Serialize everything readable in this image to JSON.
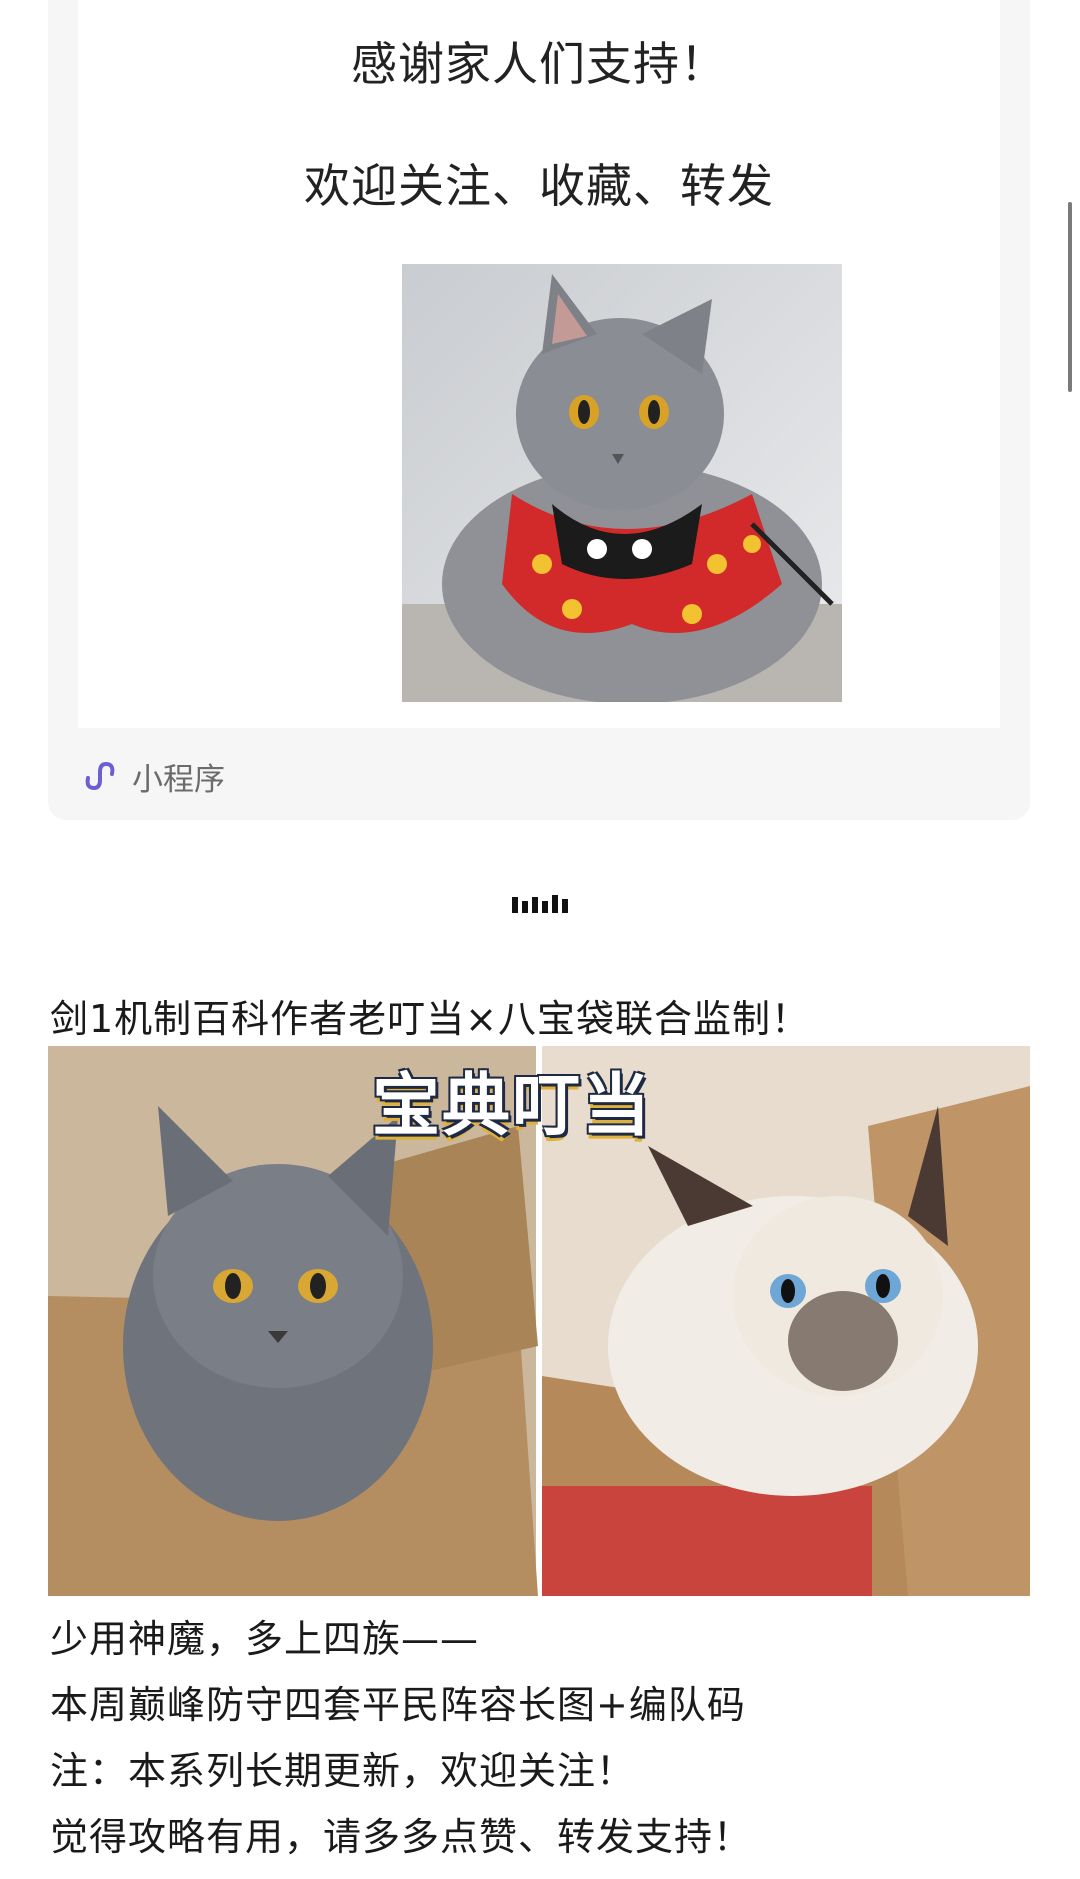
{
  "miniprogram_card": {
    "line1": "感谢家人们支持！",
    "line2": "欢迎关注、收藏、转发",
    "photo_icon": "cat-in-bib-photo",
    "footer_icon": "miniprogram-link-icon",
    "footer_label": "小程序"
  },
  "divider_icon": "equalizer-bars-icon",
  "post": {
    "title": "剑1机制百科作者老叮当×八宝袋联合监制！",
    "photo_title": "宝典叮当",
    "photo_icon": "cats-in-boxes-photo",
    "body_lines": [
      "少用神魔，多上四族——",
      "本周巅峰防守四套平民阵容长图+编队码",
      "注：本系列长期更新，欢迎关注！",
      "觉得攻略有用，请多多点赞、转发支持！"
    ]
  },
  "colors": {
    "card_bg": "#f6f6f7",
    "miniprogram_icon": "#6b5fd1",
    "text": "#1a1a1a"
  }
}
